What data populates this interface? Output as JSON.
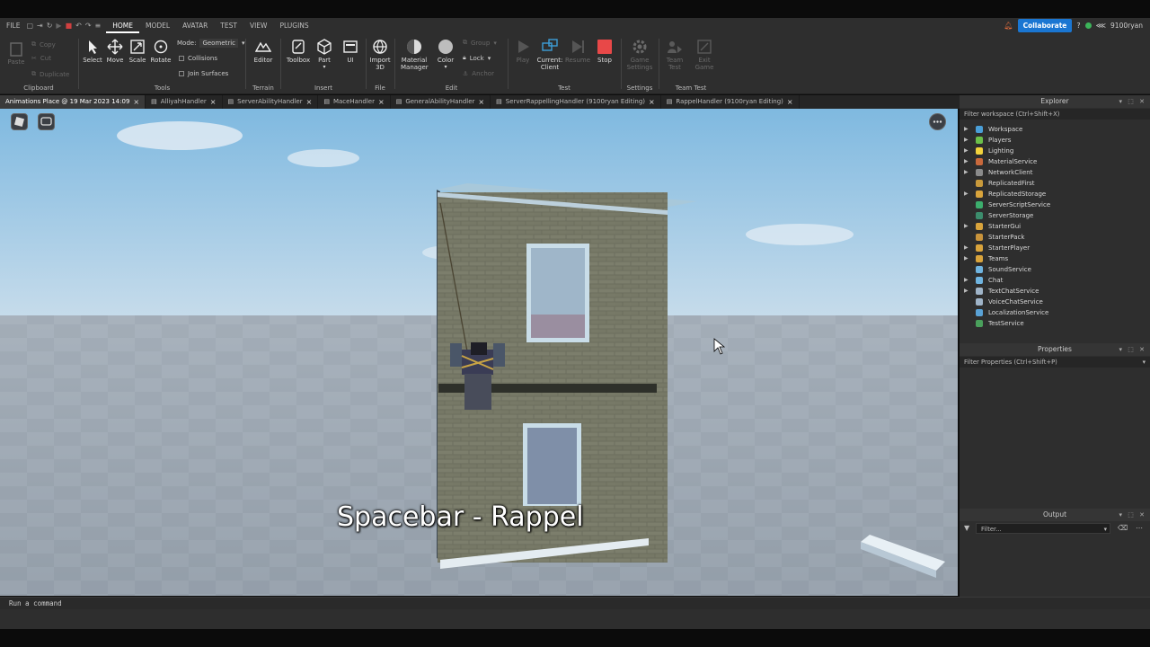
{
  "menubar": {
    "file": "FILE",
    "tabs": [
      "HOME",
      "MODEL",
      "AVATAR",
      "TEST",
      "VIEW",
      "PLUGINS"
    ],
    "active_tab": "HOME",
    "collaborate": "Collaborate",
    "username": "9100ryan"
  },
  "ribbon": {
    "clipboard": {
      "label": "Clipboard",
      "paste": "Paste",
      "copy": "Copy",
      "cut": "Cut",
      "duplicate": "Duplicate"
    },
    "tools": {
      "label": "Tools",
      "select": "Select",
      "move": "Move",
      "scale": "Scale",
      "rotate": "Rotate",
      "mode_label": "Mode:",
      "mode_value": "Geometric",
      "collisions": "Collisions",
      "join_surfaces": "Join Surfaces"
    },
    "terrain": {
      "label": "Terrain",
      "editor": "Editor"
    },
    "insert": {
      "label": "Insert",
      "toolbox": "Toolbox",
      "part": "Part",
      "ui": "UI"
    },
    "file": {
      "label": "File",
      "import3d_1": "Import",
      "import3d_2": "3D"
    },
    "edit": {
      "label": "Edit",
      "material_1": "Material",
      "material_2": "Manager",
      "color": "Color",
      "group": "Group",
      "lock": "Lock",
      "anchor": "Anchor"
    },
    "test": {
      "label": "Test",
      "play": "Play",
      "current_1": "Current:",
      "current_2": "Client",
      "resume": "Resume",
      "stop": "Stop"
    },
    "settings": {
      "label": "Settings",
      "game_1": "Game",
      "game_2": "Settings"
    },
    "teamtest": {
      "label": "Team Test",
      "team_1": "Team",
      "team_2": "Test",
      "exit_1": "Exit",
      "exit_2": "Game"
    }
  },
  "doc_tabs": [
    "Animations Place @ 19 Mar 2023 14:09",
    "AlliyahHandler",
    "ServerAbilityHandler",
    "MaceHandler",
    "GeneralAbilityHandler",
    "ServerRappellingHandler (9100ryan Editing)",
    "RappelHandler (9100ryan Editing)"
  ],
  "viewport": {
    "caption": "Spacebar - Rappel"
  },
  "explorer": {
    "title": "Explorer",
    "filter": "Filter workspace (Ctrl+Shift+X)",
    "items": [
      {
        "label": "Workspace",
        "icon": "workspace-icon",
        "color": "#4a9fd8",
        "expand": true
      },
      {
        "label": "Players",
        "icon": "players-icon",
        "color": "#6cc04a",
        "expand": true
      },
      {
        "label": "Lighting",
        "icon": "lighting-icon",
        "color": "#f2d23c",
        "expand": true
      },
      {
        "label": "MaterialService",
        "icon": "material-icon",
        "color": "#c9693c",
        "expand": true
      },
      {
        "label": "NetworkClient",
        "icon": "network-icon",
        "color": "#8b8b8b",
        "expand": true
      },
      {
        "label": "ReplicatedFirst",
        "icon": "replicated-first-icon",
        "color": "#c99a3c",
        "expand": false
      },
      {
        "label": "ReplicatedStorage",
        "icon": "replicated-storage-icon",
        "color": "#d9a43c",
        "expand": true
      },
      {
        "label": "ServerScriptService",
        "icon": "server-script-icon",
        "color": "#3cae6d",
        "expand": false
      },
      {
        "label": "ServerStorage",
        "icon": "server-storage-icon",
        "color": "#3c8d6d",
        "expand": false
      },
      {
        "label": "StarterGui",
        "icon": "starter-gui-icon",
        "color": "#d9a43c",
        "expand": true
      },
      {
        "label": "StarterPack",
        "icon": "starter-pack-icon",
        "color": "#c9943c",
        "expand": false
      },
      {
        "label": "StarterPlayer",
        "icon": "starter-player-icon",
        "color": "#d9a43c",
        "expand": true
      },
      {
        "label": "Teams",
        "icon": "teams-icon",
        "color": "#d9a43c",
        "expand": true
      },
      {
        "label": "SoundService",
        "icon": "sound-icon",
        "color": "#6fb4e0",
        "expand": false
      },
      {
        "label": "Chat",
        "icon": "chat-icon",
        "color": "#6fb4e0",
        "expand": true
      },
      {
        "label": "TextChatService",
        "icon": "text-chat-icon",
        "color": "#9fb4c8",
        "expand": true
      },
      {
        "label": "VoiceChatService",
        "icon": "voice-chat-icon",
        "color": "#9fb4c8",
        "expand": false
      },
      {
        "label": "LocalizationService",
        "icon": "localization-icon",
        "color": "#5aa2d6",
        "expand": false
      },
      {
        "label": "TestService",
        "icon": "test-service-icon",
        "color": "#4aa05c",
        "expand": false
      }
    ]
  },
  "properties": {
    "title": "Properties",
    "filter": "Filter Properties (Ctrl+Shift+P)"
  },
  "output": {
    "title": "Output",
    "filter": "Filter..."
  },
  "command_bar": {
    "placeholder": "Run a command"
  }
}
